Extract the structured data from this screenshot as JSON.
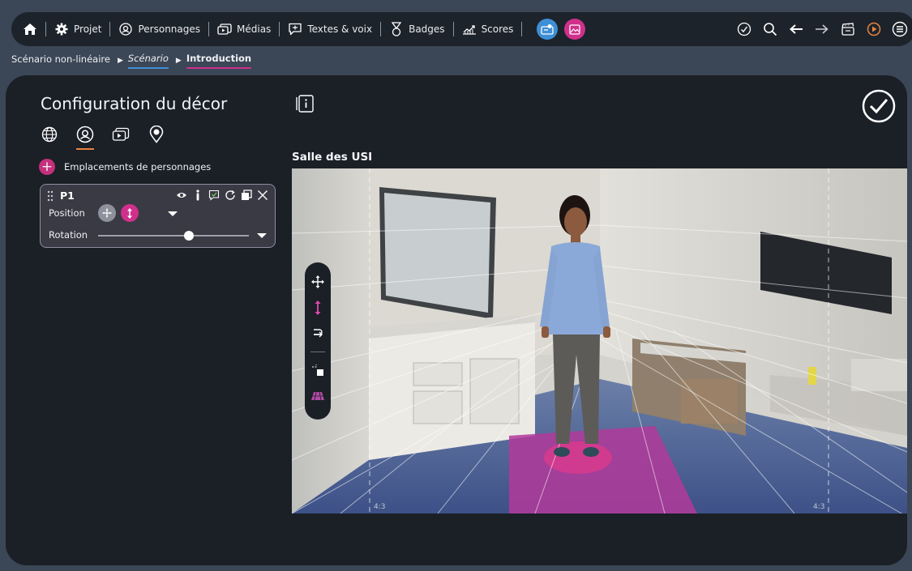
{
  "nav": {
    "home_icon": "home-icon",
    "items": [
      {
        "label": "Projet",
        "icon": "gear-icon"
      },
      {
        "label": "Personnages",
        "icon": "character-icon"
      },
      {
        "label": "Médias",
        "icon": "media-icon"
      },
      {
        "label": "Textes & voix",
        "icon": "speech-icon"
      },
      {
        "label": "Badges",
        "icon": "badge-icon"
      },
      {
        "label": "Scores",
        "icon": "scores-icon"
      }
    ],
    "mode_buttons": [
      {
        "icon": "scenario-mode-icon",
        "color": "#3f8fd6"
      },
      {
        "icon": "decor-mode-icon",
        "color": "#d0308b"
      }
    ],
    "right_tools": [
      "validate-icon",
      "search-icon",
      "undo-arrow-icon",
      "redo-arrow-icon",
      "clapperboard-icon",
      "play-icon",
      "menu-icon"
    ]
  },
  "breadcrumb": {
    "root": "Scénario non-linéaire",
    "scenario": "Scénario",
    "current": "Introduction"
  },
  "config": {
    "title": "Configuration du décor",
    "tabs": [
      "globe-icon",
      "character-icon",
      "media-icon",
      "location-pin-icon"
    ],
    "active_tab": "character-icon",
    "add_label": "Emplacements de personnages",
    "slot": {
      "name": "P1",
      "position_label": "Position",
      "rotation_label": "Rotation",
      "rotation_value": 0.6
    }
  },
  "scene": {
    "title": "Salle des USI",
    "ratio_left": "4:3",
    "ratio_right": "4:3",
    "tools": [
      "move-icon",
      "vertical-move-icon",
      "rotate-icon",
      "scale-icon",
      "floor-icon"
    ]
  },
  "colors": {
    "accent_pink": "#d0308b",
    "accent_blue": "#3f8fd6",
    "accent_orange": "#e7833f"
  }
}
